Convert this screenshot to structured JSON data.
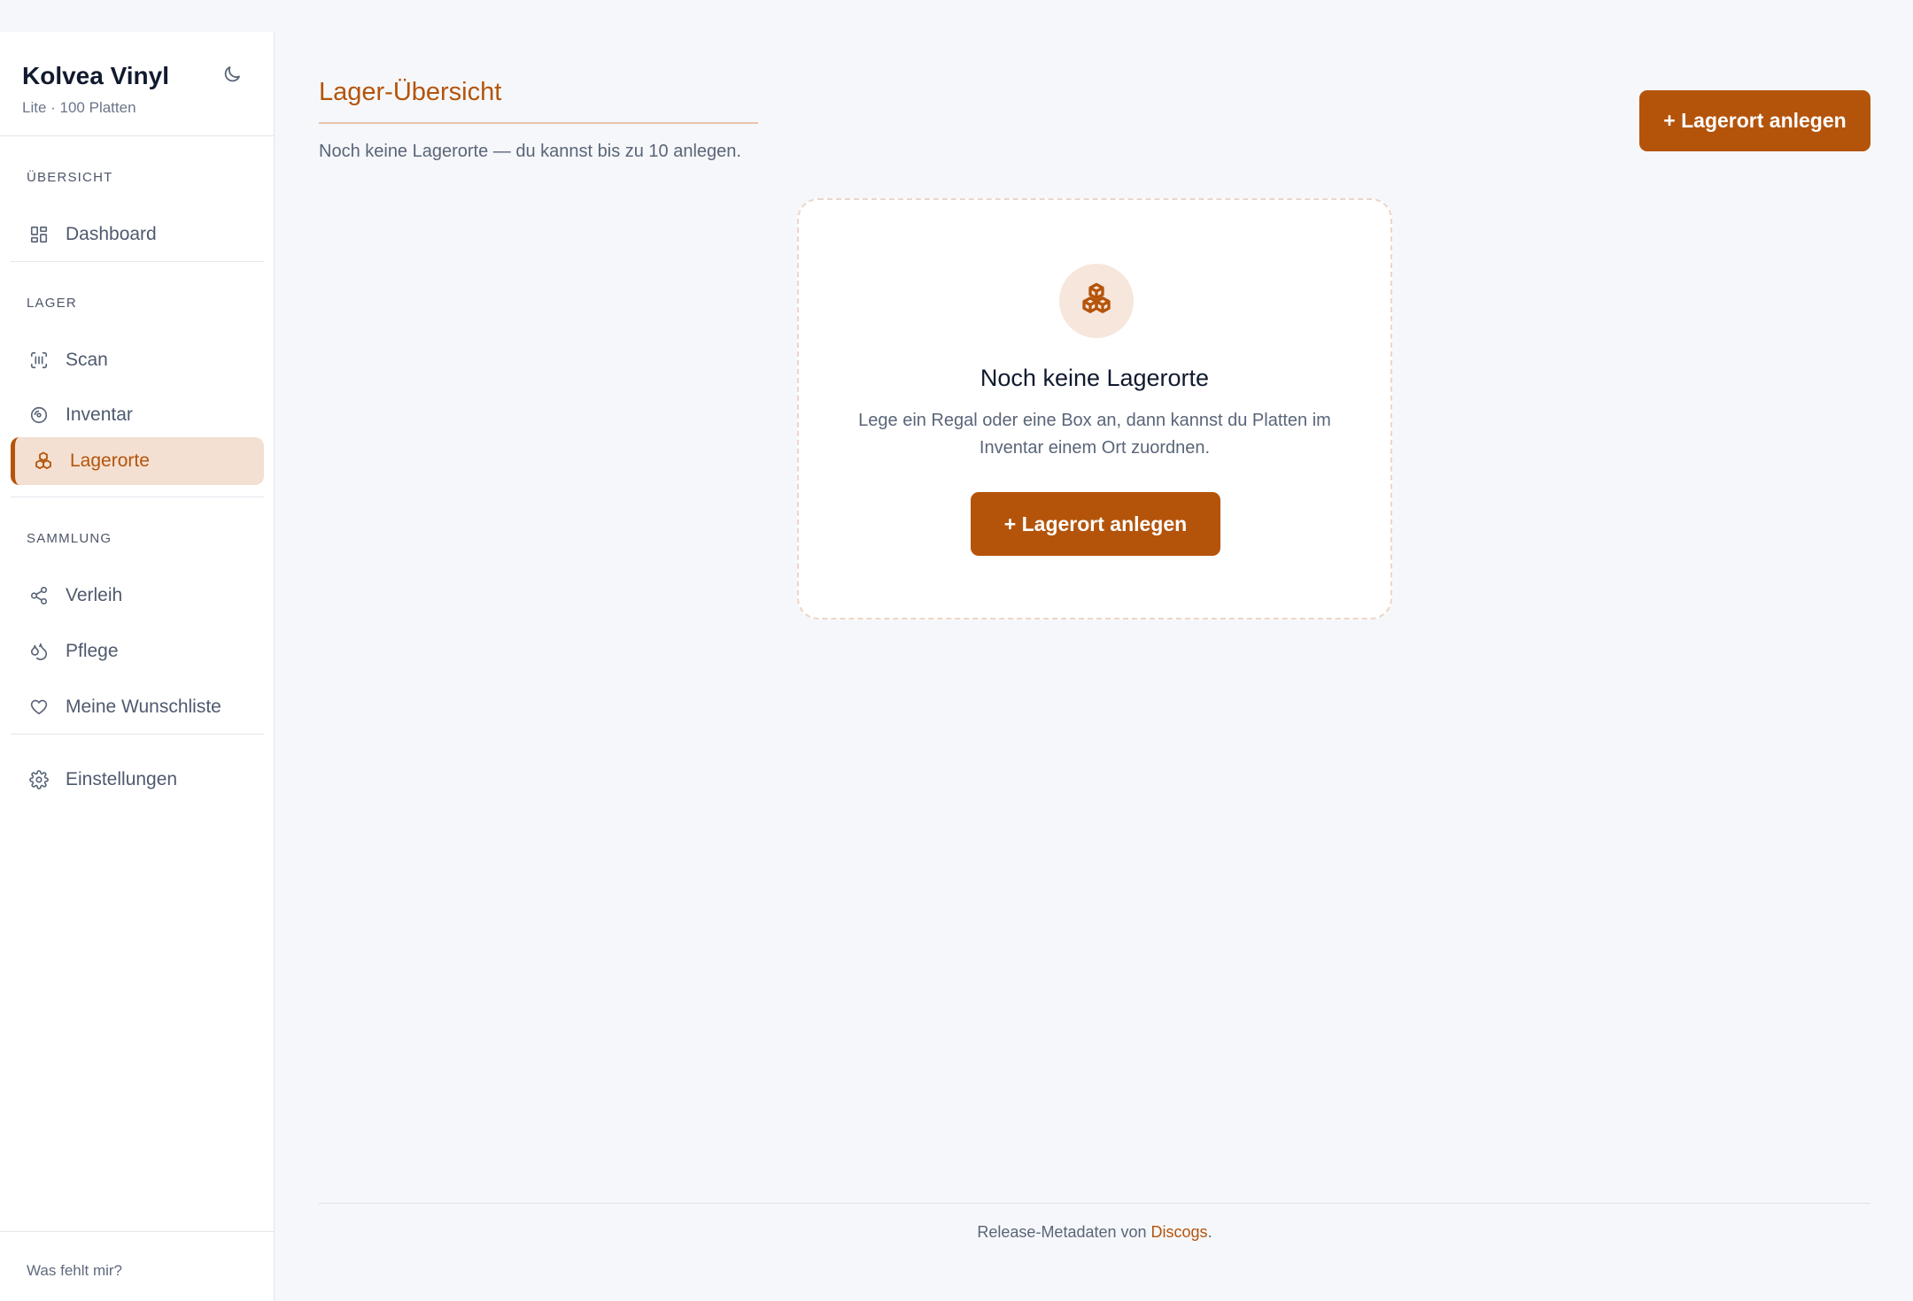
{
  "sidebar": {
    "brand": {
      "name": "Kolvea Vinyl",
      "subtitle": "Lite · 100 Platten"
    },
    "theme_toggle_icon": "moon-icon",
    "sections": {
      "overview": {
        "label": "ÜBERSICHT",
        "items": [
          {
            "label": "Dashboard",
            "icon": "dashboard-icon"
          }
        ]
      },
      "storage": {
        "label": "LAGER",
        "items": [
          {
            "label": "Scan",
            "icon": "barcode-scan-icon"
          },
          {
            "label": "Inventar",
            "icon": "record-disc-icon"
          },
          {
            "label": "Lagerorte",
            "icon": "boxes-icon",
            "active": true
          }
        ]
      },
      "collection": {
        "label": "SAMMLUNG",
        "items": [
          {
            "label": "Verleih",
            "icon": "share-icon"
          },
          {
            "label": "Pflege",
            "icon": "droplets-icon"
          },
          {
            "label": "Meine Wunschliste",
            "icon": "heart-icon"
          }
        ]
      },
      "settings": {
        "items": [
          {
            "label": "Einstellungen",
            "icon": "gear-icon"
          }
        ]
      }
    },
    "footer_link": "Was fehlt mir?"
  },
  "main": {
    "title": "Lager-Übersicht",
    "subtitle": "Noch keine Lagerorte — du kannst bis zu 10 anlegen.",
    "add_button_label": "+ Lagerort anlegen",
    "empty_state": {
      "icon": "boxes-icon",
      "title": "Noch keine Lagerorte",
      "description": "Lege ein Regal oder eine Box an, dann kannst du Platten im Inventar einem Ort zuordnen.",
      "button_label": "+ Lagerort anlegen"
    },
    "footer": {
      "prefix": "Release-Metadaten von ",
      "link": "Discogs",
      "suffix": "."
    }
  },
  "colors": {
    "accent": "#b4540b",
    "active_bg": "#f3e0d2",
    "page_bg": "#f6f7fa"
  }
}
